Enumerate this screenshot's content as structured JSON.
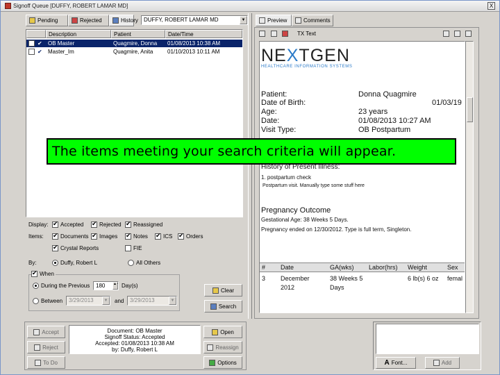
{
  "window": {
    "title": "Signoff Queue   [DUFFY, ROBERT LAMAR MD]",
    "close_label": "X"
  },
  "left": {
    "tabs": [
      {
        "label": "Pending"
      },
      {
        "label": "Rejected"
      },
      {
        "label": "History"
      }
    ],
    "provider_select": "DUFFY, ROBERT LAMAR MD",
    "columns": [
      "",
      "Description",
      "Patient",
      "Date/Time"
    ],
    "rows": [
      {
        "description": "OB Master",
        "patient": "Quagmire, Donna",
        "datetime": "01/08/2013 10:38 AM",
        "selected": true
      },
      {
        "description": "Master_Im",
        "patient": "Quagmire, Anita",
        "datetime": "01/10/2013 10:11 AM",
        "selected": false
      }
    ],
    "display": {
      "label": "Display:",
      "options": [
        {
          "label": "Accepted",
          "checked": true
        },
        {
          "label": "Rejected",
          "checked": true
        },
        {
          "label": "Reassigned",
          "checked": true
        }
      ]
    },
    "items": {
      "label": "Items:",
      "row1": [
        {
          "label": "Documents",
          "checked": true
        },
        {
          "label": "Images",
          "checked": true
        },
        {
          "label": "Notes",
          "checked": true
        },
        {
          "label": "ICS",
          "checked": true
        },
        {
          "label": "Orders",
          "checked": true
        }
      ],
      "row2": [
        {
          "label": "Crystal Reports",
          "checked": true
        },
        {
          "label": "FIE",
          "checked": false
        }
      ]
    },
    "by": {
      "label": "By:",
      "options": [
        {
          "label": "Duffy, Robert L",
          "checked": true
        },
        {
          "label": "All Others",
          "checked": false
        }
      ]
    },
    "when": {
      "label": "When",
      "checked": true,
      "previous_label": "During the Previous",
      "previous_value": "180",
      "days_label": "Day(s)",
      "between_label": "Between",
      "start": "3/29/2013",
      "and_label": "and",
      "end": "3/29/2013"
    },
    "clear_label": "Clear",
    "search_label": "Search"
  },
  "right": {
    "tabs": [
      {
        "label": "Preview"
      },
      {
        "label": "Comments"
      }
    ],
    "toolbar_text": "TX Text",
    "document": {
      "logo_left": "NE",
      "logo_x": "X",
      "logo_right": "TGEN",
      "logo_sub": "HEALTHCARE INFORMATION SYSTEMS",
      "fields": [
        {
          "label": "Patient:",
          "value": "Donna Quagmire"
        },
        {
          "label": "Date of Birth:",
          "value": "01/03/19"
        },
        {
          "label": "Age:",
          "value": "23 years"
        },
        {
          "label": "Date:",
          "value": "01/08/2013 10:27 AM"
        },
        {
          "label": "Visit Type:",
          "value": "OB Postpartum"
        }
      ],
      "hpi_title": "History of Present Illness:",
      "hpi_line1": "1.  postpartum check",
      "hpi_line2": "Postpartum visit.  Manually type some stuff here",
      "outcome_title": "Pregnancy Outcome",
      "outcome_line1": "Gestational Age: 38 Weeks 5 Days.",
      "outcome_line2": "Pregnancy ended on 12/30/2012. Type is full term, Singleton.",
      "table_headers": [
        "#",
        "Date",
        "GA(wks)",
        "Labor(hrs)",
        "Weight",
        "Sex"
      ],
      "table_row": [
        "3",
        "December",
        "38 Weeks 5",
        "",
        "6 lb(s) 6 oz",
        "femal"
      ],
      "table_row2": [
        "",
        "2012",
        "Days",
        "",
        "",
        ""
      ]
    }
  },
  "bottom": {
    "accept_label": "Accept",
    "reject_label": "Reject",
    "todo_label": "To Do",
    "status_lines": [
      "Document: OB Master",
      "Signoff Status: Accepted",
      "Accepted: 01/08/2013 10:38 AM",
      "by: Duffy, Robert L"
    ],
    "open_label": "Open",
    "reassign_label": "Reassign",
    "options_label": "Options",
    "font_label": "Font...",
    "add_label": "Add"
  },
  "overlay": {
    "caption": "The items meeting your search criteria will appear."
  },
  "colors": {
    "selection": "#0a246a",
    "caption_bg": "#00ff00",
    "logo_accent": "#2a7ac8"
  }
}
